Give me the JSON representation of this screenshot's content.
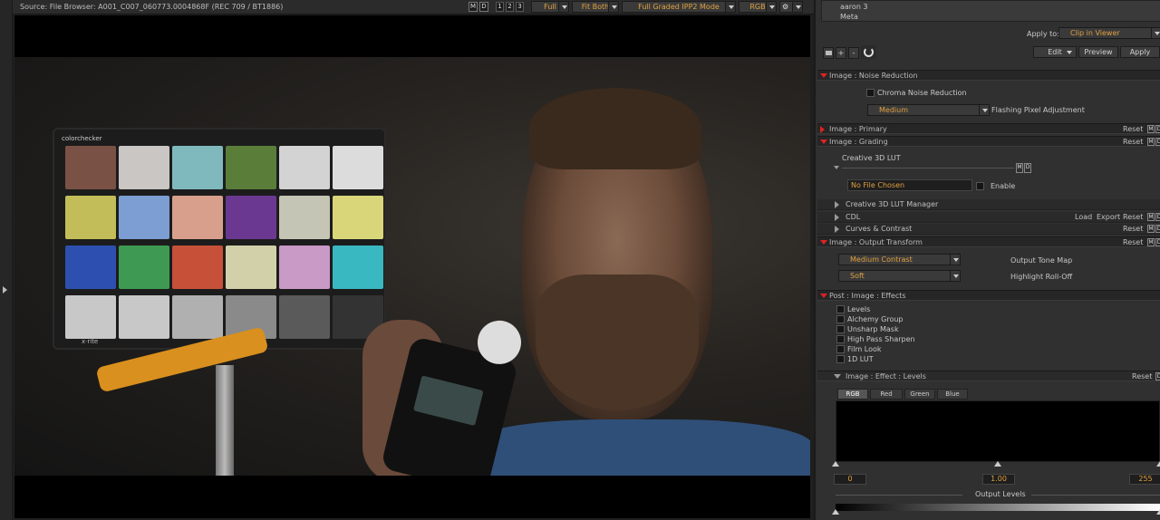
{
  "viewer": {
    "source_label": "Source: File Browser: A001_C007_060773.0004868F    (REC 709 / BT1886)",
    "m_label": "M",
    "d_label": "D",
    "buffers": [
      "1",
      "2",
      "3"
    ],
    "quality": "Full",
    "fit": "Fit Both",
    "mode": "Full Graded IPP2 Mode",
    "channel": "RGB",
    "chart_header": "colorchecker",
    "chart_brand": "x·rite",
    "swatch_colors": [
      "#7a5245",
      "#c9c6c3",
      "#7fb9be",
      "#5a7e3a",
      "#d3d3d3",
      "#dcdcdc",
      "#c2bd58",
      "#7c9ed2",
      "#d8a08c",
      "#6a3890",
      "#c5c5b5",
      "#d9d67a",
      "#2d50b0",
      "#3e9a52",
      "#c65038",
      "#d2d0a8",
      "#c99ac6",
      "#3ab8c2",
      "#c8c8c8",
      "#c8c8c8",
      "#b0b0b0",
      "#8a8a8a",
      "#5a5a5a",
      "#333333"
    ]
  },
  "panel": {
    "list_items": [
      "aaron 3",
      "Meta"
    ],
    "apply_to_label": "Apply to:",
    "apply_to_value": "Clip in Viewer",
    "plus": "+",
    "minus": "-",
    "edit_label": "Edit",
    "preview_label": "Preview",
    "apply_label": "Apply",
    "noise_reduction": {
      "title": "Image : Noise Reduction",
      "chroma_label": "Chroma Noise Reduction",
      "flash_value": "Medium",
      "flash_label": "Flashing Pixel Adjustment"
    },
    "primary_title": "Image : Primary",
    "grading": {
      "title": "Image : Grading",
      "lut_label": "Creative 3D LUT",
      "file_value": "No File Chosen",
      "enable_label": "Enable"
    },
    "lut_manager_label": "Creative 3D LUT Manager",
    "cdl_label": "CDL",
    "load_label": "Load",
    "export_label": "Export",
    "curves_label": "Curves & Contrast",
    "output_transform": {
      "title": "Image : Output Transform",
      "tone_value": "Medium Contrast",
      "tone_label": "Output Tone Map",
      "rolloff_value": "Soft",
      "rolloff_label": "Highlight Roll-Off"
    },
    "effects": {
      "title": "Post : Image : Effects",
      "items": [
        "Levels",
        "Alchemy Group",
        "Unsharp Mask",
        "High Pass Sharpen",
        "Film Look",
        "1D LUT"
      ]
    },
    "levels": {
      "title": "Image : Effect : Levels",
      "tabs": [
        "RGB",
        "Red",
        "Green",
        "Blue"
      ],
      "black": "0",
      "gamma": "1.00",
      "white": "255",
      "output_label": "Output Levels"
    },
    "reset_label": "Reset",
    "m_label": "M",
    "d_label": "D"
  }
}
